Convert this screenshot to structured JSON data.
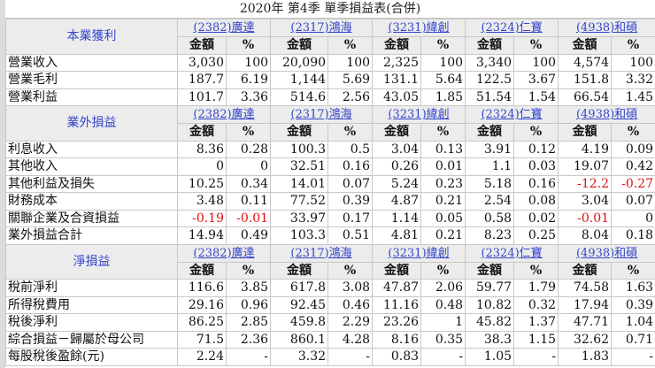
{
  "title": "2020年 第4季 單季損益表(合併)",
  "col_amount": "金額",
  "col_pct": "%",
  "colors": {
    "link": "#3344cc",
    "negative": "#e01010",
    "header_bg": "#ececec"
  },
  "companies": [
    "(2382)廣達",
    "(2317)鴻海",
    "(3231)緯創",
    "(2324)仁寶",
    "(4938)和碩"
  ],
  "sections": [
    {
      "name": "本業獲利",
      "rows": [
        {
          "label": "營業收入",
          "values": [
            "3,030",
            "100",
            "20,090",
            "100",
            "2,325",
            "100",
            "3,340",
            "100",
            "4,574",
            "100"
          ]
        },
        {
          "label": "營業毛利",
          "values": [
            "187.7",
            "6.19",
            "1,144",
            "5.69",
            "131.1",
            "5.64",
            "122.5",
            "3.67",
            "151.8",
            "3.32"
          ]
        },
        {
          "label": "營業利益",
          "values": [
            "101.7",
            "3.36",
            "514.6",
            "2.56",
            "43.05",
            "1.85",
            "51.54",
            "1.54",
            "66.54",
            "1.45"
          ]
        }
      ]
    },
    {
      "name": "業外損益",
      "rows": [
        {
          "label": "利息收入",
          "values": [
            "8.36",
            "0.28",
            "100.3",
            "0.5",
            "3.04",
            "0.13",
            "3.91",
            "0.12",
            "4.19",
            "0.09"
          ]
        },
        {
          "label": "其他收入",
          "values": [
            "0",
            "0",
            "32.51",
            "0.16",
            "0.26",
            "0.01",
            "1.1",
            "0.03",
            "19.07",
            "0.42"
          ]
        },
        {
          "label": "其他利益及損失",
          "values": [
            "10.25",
            "0.34",
            "14.01",
            "0.07",
            "5.24",
            "0.23",
            "5.18",
            "0.16",
            "-12.2",
            "-0.27"
          ]
        },
        {
          "label": "財務成本",
          "values": [
            "3.48",
            "0.11",
            "77.52",
            "0.39",
            "4.87",
            "0.21",
            "2.54",
            "0.08",
            "3.04",
            "0.07"
          ]
        },
        {
          "label": "關聯企業及合資損益",
          "values": [
            "-0.19",
            "-0.01",
            "33.97",
            "0.17",
            "1.14",
            "0.05",
            "0.58",
            "0.02",
            "-0.01",
            "0"
          ]
        },
        {
          "label": "業外損益合計",
          "values": [
            "14.94",
            "0.49",
            "103.3",
            "0.51",
            "4.81",
            "0.21",
            "8.23",
            "0.25",
            "8.04",
            "0.18"
          ]
        }
      ]
    },
    {
      "name": "淨損益",
      "rows": [
        {
          "label": "稅前淨利",
          "values": [
            "116.6",
            "3.85",
            "617.8",
            "3.08",
            "47.87",
            "2.06",
            "59.77",
            "1.79",
            "74.58",
            "1.63"
          ]
        },
        {
          "label": "所得稅費用",
          "values": [
            "29.16",
            "0.96",
            "92.45",
            "0.46",
            "11.16",
            "0.48",
            "10.82",
            "0.32",
            "17.94",
            "0.39"
          ]
        },
        {
          "label": "稅後淨利",
          "values": [
            "86.25",
            "2.85",
            "459.8",
            "2.29",
            "23.26",
            "1",
            "45.82",
            "1.37",
            "47.71",
            "1.04"
          ]
        },
        {
          "label": "綜合損益－歸屬於母公司",
          "values": [
            "71.5",
            "2.36",
            "860.1",
            "4.28",
            "8.16",
            "0.35",
            "38.3",
            "1.15",
            "32.62",
            "0.71"
          ]
        },
        {
          "label": "每股稅後盈餘(元)",
          "values": [
            "2.24",
            "-",
            "3.32",
            "-",
            "0.83",
            "-",
            "1.05",
            "-",
            "1.83",
            "-"
          ]
        }
      ]
    }
  ]
}
